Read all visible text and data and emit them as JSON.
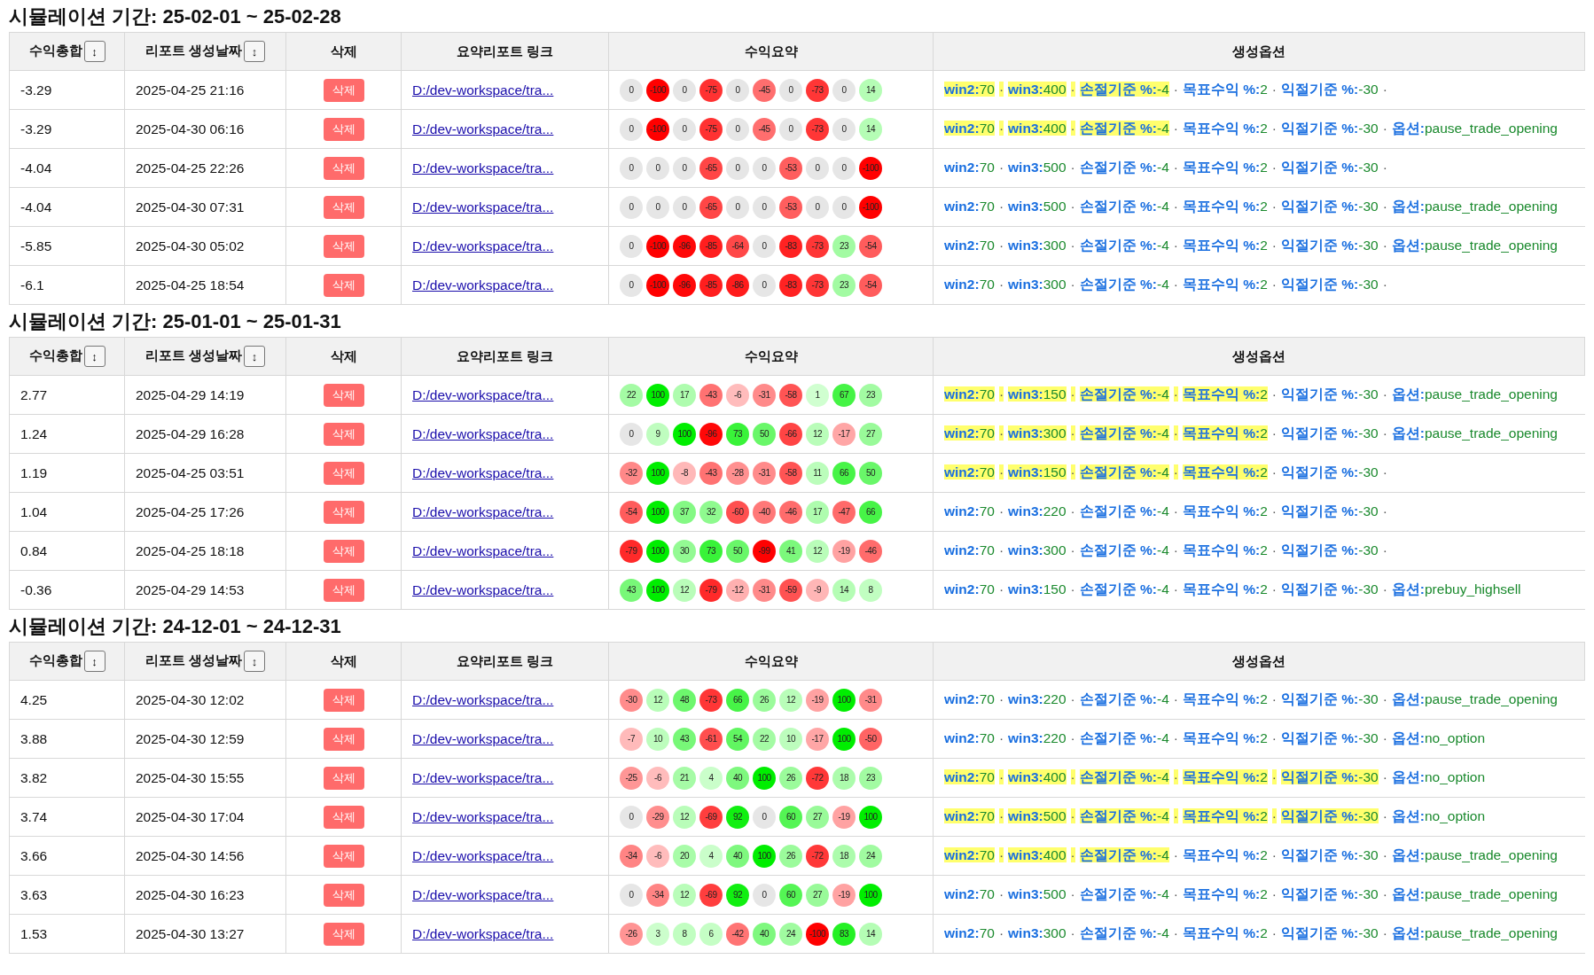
{
  "separator": "·",
  "sections": [
    {
      "title": "시뮬레이션 기간: 25-02-01 ~ 25-02-28",
      "columns": [
        {
          "label": "수익총합",
          "sort": "↕"
        },
        {
          "label": "리포트 생성날짜",
          "sort": "↕"
        },
        {
          "label": "삭제"
        },
        {
          "label": "요약리포트 링크"
        },
        {
          "label": "수익요약"
        },
        {
          "label": "생성옵션"
        }
      ],
      "rows": [
        {
          "total": "-3.29",
          "date": "2025-04-25 21:16",
          "delete": "삭제",
          "link": "D:/dev-workspace/tra...",
          "summary": [
            "0",
            "-100",
            "0",
            "-75",
            "0",
            "-45",
            "0",
            "-73",
            "0",
            "14"
          ],
          "trailing_separator": true,
          "options": [
            {
              "key": "win2:",
              "value": "70",
              "highlighted": true
            },
            {
              "key": "win3:",
              "value": "400",
              "highlighted": true
            },
            {
              "key": "손절기준 %:",
              "value": "-4",
              "highlighted": true
            },
            {
              "key": "목표수익 %:",
              "value": "2",
              "highlighted": false
            },
            {
              "key": "익절기준 %:",
              "value": "-30",
              "highlighted": false
            }
          ]
        },
        {
          "total": "-3.29",
          "date": "2025-04-30 06:16",
          "delete": "삭제",
          "link": "D:/dev-workspace/tra...",
          "summary": [
            "0",
            "-100",
            "0",
            "-75",
            "0",
            "-45",
            "0",
            "-73",
            "0",
            "14"
          ],
          "trailing_separator": false,
          "options": [
            {
              "key": "win2:",
              "value": "70",
              "highlighted": true
            },
            {
              "key": "win3:",
              "value": "400",
              "highlighted": true
            },
            {
              "key": "손절기준 %:",
              "value": "-4",
              "highlighted": true
            },
            {
              "key": "목표수익 %:",
              "value": "2",
              "highlighted": false
            },
            {
              "key": "익절기준 %:",
              "value": "-30",
              "highlighted": false
            },
            {
              "key": "옵션:",
              "value": "pause_trade_opening",
              "highlighted": false
            }
          ]
        },
        {
          "total": "-4.04",
          "date": "2025-04-25 22:26",
          "delete": "삭제",
          "link": "D:/dev-workspace/tra...",
          "summary": [
            "0",
            "0",
            "0",
            "-65",
            "0",
            "0",
            "-53",
            "0",
            "0",
            "-100"
          ],
          "trailing_separator": true,
          "options": [
            {
              "key": "win2:",
              "value": "70",
              "highlighted": false
            },
            {
              "key": "win3:",
              "value": "500",
              "highlighted": false
            },
            {
              "key": "손절기준 %:",
              "value": "-4",
              "highlighted": false
            },
            {
              "key": "목표수익 %:",
              "value": "2",
              "highlighted": false
            },
            {
              "key": "익절기준 %:",
              "value": "-30",
              "highlighted": false
            }
          ]
        },
        {
          "total": "-4.04",
          "date": "2025-04-30 07:31",
          "delete": "삭제",
          "link": "D:/dev-workspace/tra...",
          "summary": [
            "0",
            "0",
            "0",
            "-65",
            "0",
            "0",
            "-53",
            "0",
            "0",
            "-100"
          ],
          "trailing_separator": false,
          "options": [
            {
              "key": "win2:",
              "value": "70",
              "highlighted": false
            },
            {
              "key": "win3:",
              "value": "500",
              "highlighted": false
            },
            {
              "key": "손절기준 %:",
              "value": "-4",
              "highlighted": false
            },
            {
              "key": "목표수익 %:",
              "value": "2",
              "highlighted": false
            },
            {
              "key": "익절기준 %:",
              "value": "-30",
              "highlighted": false
            },
            {
              "key": "옵션:",
              "value": "pause_trade_opening",
              "highlighted": false
            }
          ]
        },
        {
          "total": "-5.85",
          "date": "2025-04-30 05:02",
          "delete": "삭제",
          "link": "D:/dev-workspace/tra...",
          "summary": [
            "0",
            "-100",
            "-96",
            "-85",
            "-64",
            "0",
            "-83",
            "-73",
            "23",
            "-54"
          ],
          "trailing_separator": false,
          "options": [
            {
              "key": "win2:",
              "value": "70",
              "highlighted": false
            },
            {
              "key": "win3:",
              "value": "300",
              "highlighted": false
            },
            {
              "key": "손절기준 %:",
              "value": "-4",
              "highlighted": false
            },
            {
              "key": "목표수익 %:",
              "value": "2",
              "highlighted": false
            },
            {
              "key": "익절기준 %:",
              "value": "-30",
              "highlighted": false
            },
            {
              "key": "옵션:",
              "value": "pause_trade_opening",
              "highlighted": false
            }
          ]
        },
        {
          "total": "-6.1",
          "date": "2025-04-25 18:54",
          "delete": "삭제",
          "link": "D:/dev-workspace/tra...",
          "summary": [
            "0",
            "-100",
            "-96",
            "-85",
            "-86",
            "0",
            "-83",
            "-73",
            "23",
            "-54"
          ],
          "trailing_separator": true,
          "options": [
            {
              "key": "win2:",
              "value": "70",
              "highlighted": false
            },
            {
              "key": "win3:",
              "value": "300",
              "highlighted": false
            },
            {
              "key": "손절기준 %:",
              "value": "-4",
              "highlighted": false
            },
            {
              "key": "목표수익 %:",
              "value": "2",
              "highlighted": false
            },
            {
              "key": "익절기준 %:",
              "value": "-30",
              "highlighted": false
            }
          ]
        }
      ]
    },
    {
      "title": "시뮬레이션 기간: 25-01-01 ~ 25-01-31",
      "columns": [
        {
          "label": "수익총합",
          "sort": "↕"
        },
        {
          "label": "리포트 생성날짜",
          "sort": "↕"
        },
        {
          "label": "삭제"
        },
        {
          "label": "요약리포트 링크"
        },
        {
          "label": "수익요약"
        },
        {
          "label": "생성옵션"
        }
      ],
      "rows": [
        {
          "total": "2.77",
          "date": "2025-04-29 14:19",
          "delete": "삭제",
          "link": "D:/dev-workspace/tra...",
          "summary": [
            "22",
            "100",
            "17",
            "-43",
            "-6",
            "-31",
            "-58",
            "1",
            "67",
            "23"
          ],
          "trailing_separator": false,
          "options": [
            {
              "key": "win2:",
              "value": "70",
              "highlighted": true
            },
            {
              "key": "win3:",
              "value": "150",
              "highlighted": true
            },
            {
              "key": "손절기준 %:",
              "value": "-4",
              "highlighted": true
            },
            {
              "key": "목표수익 %:",
              "value": "2",
              "highlighted": true
            },
            {
              "key": "익절기준 %:",
              "value": "-30",
              "highlighted": false
            },
            {
              "key": "옵션:",
              "value": "pause_trade_opening",
              "highlighted": false
            }
          ]
        },
        {
          "total": "1.24",
          "date": "2025-04-29 16:28",
          "delete": "삭제",
          "link": "D:/dev-workspace/tra...",
          "summary": [
            "0",
            "9",
            "100",
            "-96",
            "73",
            "50",
            "-66",
            "12",
            "-17",
            "27"
          ],
          "trailing_separator": false,
          "options": [
            {
              "key": "win2:",
              "value": "70",
              "highlighted": true
            },
            {
              "key": "win3:",
              "value": "300",
              "highlighted": true
            },
            {
              "key": "손절기준 %:",
              "value": "-4",
              "highlighted": true
            },
            {
              "key": "목표수익 %:",
              "value": "2",
              "highlighted": true
            },
            {
              "key": "익절기준 %:",
              "value": "-30",
              "highlighted": false
            },
            {
              "key": "옵션:",
              "value": "pause_trade_opening",
              "highlighted": false
            }
          ]
        },
        {
          "total": "1.19",
          "date": "2025-04-25 03:51",
          "delete": "삭제",
          "link": "D:/dev-workspace/tra...",
          "summary": [
            "-32",
            "100",
            "-8",
            "-43",
            "-28",
            "-31",
            "-58",
            "11",
            "66",
            "50"
          ],
          "trailing_separator": true,
          "options": [
            {
              "key": "win2:",
              "value": "70",
              "highlighted": true
            },
            {
              "key": "win3:",
              "value": "150",
              "highlighted": true
            },
            {
              "key": "손절기준 %:",
              "value": "-4",
              "highlighted": true
            },
            {
              "key": "목표수익 %:",
              "value": "2",
              "highlighted": true
            },
            {
              "key": "익절기준 %:",
              "value": "-30",
              "highlighted": false
            }
          ]
        },
        {
          "total": "1.04",
          "date": "2025-04-25 17:26",
          "delete": "삭제",
          "link": "D:/dev-workspace/tra...",
          "summary": [
            "-54",
            "100",
            "37",
            "32",
            "-60",
            "-40",
            "-46",
            "17",
            "-47",
            "66"
          ],
          "trailing_separator": true,
          "options": [
            {
              "key": "win2:",
              "value": "70",
              "highlighted": false
            },
            {
              "key": "win3:",
              "value": "220",
              "highlighted": false
            },
            {
              "key": "손절기준 %:",
              "value": "-4",
              "highlighted": false
            },
            {
              "key": "목표수익 %:",
              "value": "2",
              "highlighted": false
            },
            {
              "key": "익절기준 %:",
              "value": "-30",
              "highlighted": false
            }
          ]
        },
        {
          "total": "0.84",
          "date": "2025-04-25 18:18",
          "delete": "삭제",
          "link": "D:/dev-workspace/tra...",
          "summary": [
            "-79",
            "100",
            "30",
            "73",
            "50",
            "-99",
            "41",
            "12",
            "-19",
            "-46"
          ],
          "trailing_separator": true,
          "options": [
            {
              "key": "win2:",
              "value": "70",
              "highlighted": false
            },
            {
              "key": "win3:",
              "value": "300",
              "highlighted": false
            },
            {
              "key": "손절기준 %:",
              "value": "-4",
              "highlighted": false
            },
            {
              "key": "목표수익 %:",
              "value": "2",
              "highlighted": false
            },
            {
              "key": "익절기준 %:",
              "value": "-30",
              "highlighted": false
            }
          ]
        },
        {
          "total": "-0.36",
          "date": "2025-04-29 14:53",
          "delete": "삭제",
          "link": "D:/dev-workspace/tra...",
          "summary": [
            "43",
            "100",
            "12",
            "-79",
            "-12",
            "-31",
            "-59",
            "-9",
            "14",
            "8"
          ],
          "trailing_separator": false,
          "options": [
            {
              "key": "win2:",
              "value": "70",
              "highlighted": false
            },
            {
              "key": "win3:",
              "value": "150",
              "highlighted": false
            },
            {
              "key": "손절기준 %:",
              "value": "-4",
              "highlighted": false
            },
            {
              "key": "목표수익 %:",
              "value": "2",
              "highlighted": false
            },
            {
              "key": "익절기준 %:",
              "value": "-30",
              "highlighted": false
            },
            {
              "key": "옵션:",
              "value": "prebuy_highsell",
              "highlighted": false
            }
          ]
        }
      ]
    },
    {
      "title": "시뮬레이션 기간: 24-12-01 ~ 24-12-31",
      "columns": [
        {
          "label": "수익총합",
          "sort": "↕"
        },
        {
          "label": "리포트 생성날짜",
          "sort": "↕"
        },
        {
          "label": "삭제"
        },
        {
          "label": "요약리포트 링크"
        },
        {
          "label": "수익요약"
        },
        {
          "label": "생성옵션"
        }
      ],
      "rows": [
        {
          "total": "4.25",
          "date": "2025-04-30 12:02",
          "delete": "삭제",
          "link": "D:/dev-workspace/tra...",
          "summary": [
            "-30",
            "12",
            "48",
            "-73",
            "66",
            "26",
            "12",
            "-19",
            "100",
            "-31"
          ],
          "trailing_separator": false,
          "options": [
            {
              "key": "win2:",
              "value": "70",
              "highlighted": false
            },
            {
              "key": "win3:",
              "value": "220",
              "highlighted": false
            },
            {
              "key": "손절기준 %:",
              "value": "-4",
              "highlighted": false
            },
            {
              "key": "목표수익 %:",
              "value": "2",
              "highlighted": false
            },
            {
              "key": "익절기준 %:",
              "value": "-30",
              "highlighted": false
            },
            {
              "key": "옵션:",
              "value": "pause_trade_opening",
              "highlighted": false
            }
          ]
        },
        {
          "total": "3.88",
          "date": "2025-04-30 12:59",
          "delete": "삭제",
          "link": "D:/dev-workspace/tra...",
          "summary": [
            "-7",
            "10",
            "43",
            "-61",
            "54",
            "22",
            "10",
            "-17",
            "100",
            "-50"
          ],
          "trailing_separator": false,
          "options": [
            {
              "key": "win2:",
              "value": "70",
              "highlighted": false
            },
            {
              "key": "win3:",
              "value": "220",
              "highlighted": false
            },
            {
              "key": "손절기준 %:",
              "value": "-4",
              "highlighted": false
            },
            {
              "key": "목표수익 %:",
              "value": "2",
              "highlighted": false
            },
            {
              "key": "익절기준 %:",
              "value": "-30",
              "highlighted": false
            },
            {
              "key": "옵션:",
              "value": "no_option",
              "highlighted": false
            }
          ]
        },
        {
          "total": "3.82",
          "date": "2025-04-30 15:55",
          "delete": "삭제",
          "link": "D:/dev-workspace/tra...",
          "summary": [
            "-25",
            "-6",
            "21",
            "4",
            "40",
            "100",
            "26",
            "-72",
            "18",
            "23"
          ],
          "trailing_separator": false,
          "options": [
            {
              "key": "win2:",
              "value": "70",
              "highlighted": true
            },
            {
              "key": "win3:",
              "value": "400",
              "highlighted": true
            },
            {
              "key": "손절기준 %:",
              "value": "-4",
              "highlighted": true
            },
            {
              "key": "목표수익 %:",
              "value": "2",
              "highlighted": true
            },
            {
              "key": "익절기준 %:",
              "value": "-30",
              "highlighted": true
            },
            {
              "key": "옵션:",
              "value": "no_option",
              "highlighted": false
            }
          ]
        },
        {
          "total": "3.74",
          "date": "2025-04-30 17:04",
          "delete": "삭제",
          "link": "D:/dev-workspace/tra...",
          "summary": [
            "0",
            "-29",
            "12",
            "-69",
            "92",
            "0",
            "60",
            "27",
            "-19",
            "100"
          ],
          "trailing_separator": false,
          "options": [
            {
              "key": "win2:",
              "value": "70",
              "highlighted": true
            },
            {
              "key": "win3:",
              "value": "500",
              "highlighted": true
            },
            {
              "key": "손절기준 %:",
              "value": "-4",
              "highlighted": true
            },
            {
              "key": "목표수익 %:",
              "value": "2",
              "highlighted": true
            },
            {
              "key": "익절기준 %:",
              "value": "-30",
              "highlighted": true
            },
            {
              "key": "옵션:",
              "value": "no_option",
              "highlighted": false
            }
          ]
        },
        {
          "total": "3.66",
          "date": "2025-04-30 14:56",
          "delete": "삭제",
          "link": "D:/dev-workspace/tra...",
          "summary": [
            "-34",
            "-6",
            "20",
            "4",
            "40",
            "100",
            "26",
            "-72",
            "18",
            "24"
          ],
          "trailing_separator": false,
          "options": [
            {
              "key": "win2:",
              "value": "70",
              "highlighted": true
            },
            {
              "key": "win3:",
              "value": "400",
              "highlighted": true
            },
            {
              "key": "손절기준 %:",
              "value": "-4",
              "highlighted": true
            },
            {
              "key": "목표수익 %:",
              "value": "2",
              "highlighted": false
            },
            {
              "key": "익절기준 %:",
              "value": "-30",
              "highlighted": false
            },
            {
              "key": "옵션:",
              "value": "pause_trade_opening",
              "highlighted": false
            }
          ]
        },
        {
          "total": "3.63",
          "date": "2025-04-30 16:23",
          "delete": "삭제",
          "link": "D:/dev-workspace/tra...",
          "summary": [
            "0",
            "-34",
            "12",
            "-69",
            "92",
            "0",
            "60",
            "27",
            "-19",
            "100"
          ],
          "trailing_separator": false,
          "options": [
            {
              "key": "win2:",
              "value": "70",
              "highlighted": false
            },
            {
              "key": "win3:",
              "value": "500",
              "highlighted": false
            },
            {
              "key": "손절기준 %:",
              "value": "-4",
              "highlighted": false
            },
            {
              "key": "목표수익 %:",
              "value": "2",
              "highlighted": false
            },
            {
              "key": "익절기준 %:",
              "value": "-30",
              "highlighted": false
            },
            {
              "key": "옵션:",
              "value": "pause_trade_opening",
              "highlighted": false
            }
          ]
        },
        {
          "total": "1.53",
          "date": "2025-04-30 13:27",
          "delete": "삭제",
          "link": "D:/dev-workspace/tra...",
          "summary": [
            "-26",
            "3",
            "8",
            "6",
            "-42",
            "40",
            "24",
            "-100",
            "83",
            "14"
          ],
          "trailing_separator": false,
          "options": [
            {
              "key": "win2:",
              "value": "70",
              "highlighted": false
            },
            {
              "key": "win3:",
              "value": "300",
              "highlighted": false
            },
            {
              "key": "손절기준 %:",
              "value": "-4",
              "highlighted": false
            },
            {
              "key": "목표수익 %:",
              "value": "2",
              "highlighted": false
            },
            {
              "key": "익절기준 %:",
              "value": "-30",
              "highlighted": false
            },
            {
              "key": "옵션:",
              "value": "pause_trade_opening",
              "highlighted": false
            }
          ]
        }
      ]
    }
  ]
}
